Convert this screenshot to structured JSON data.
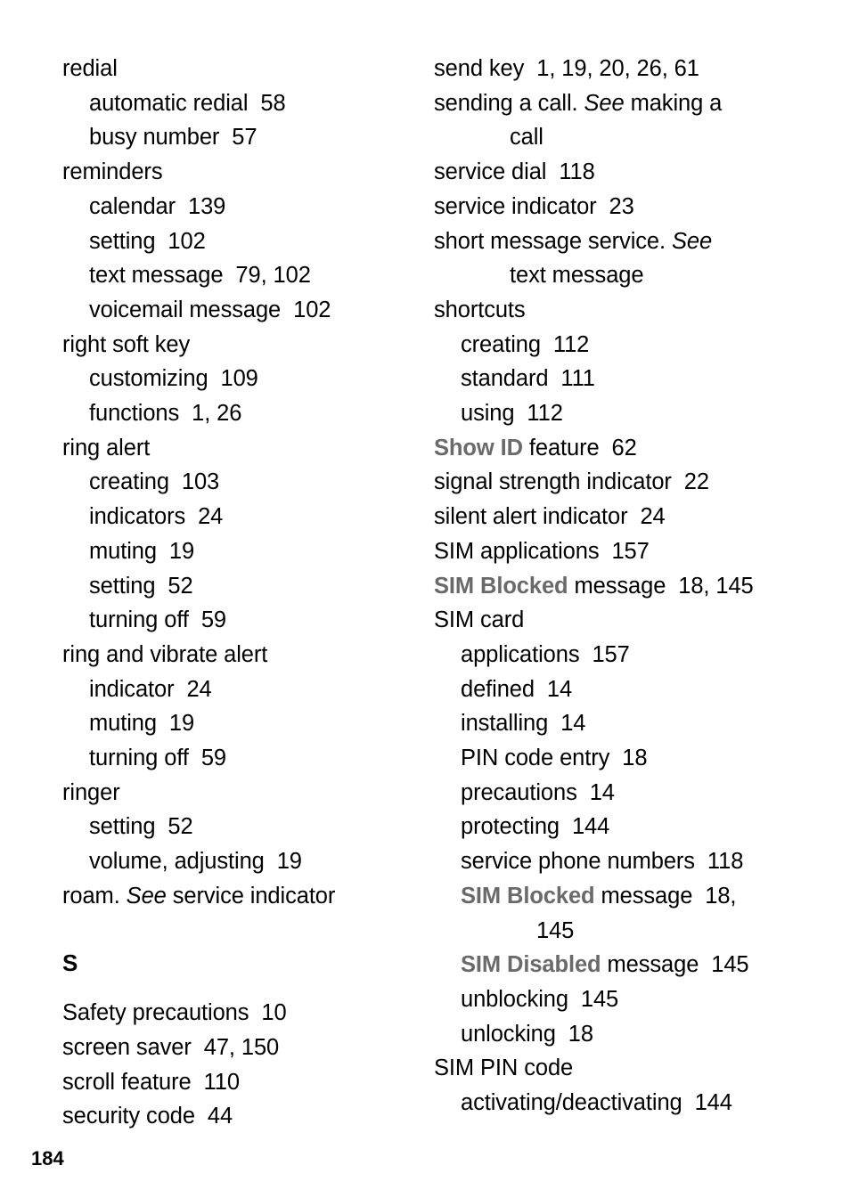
{
  "document": {
    "type": "book-index",
    "page_number": "184",
    "colors": {
      "text": "#000000",
      "ui_term": "#6a6a6a",
      "background": "#ffffff"
    }
  },
  "left_column": {
    "entries": [
      {
        "level": 1,
        "text": "redial"
      },
      {
        "level": 2,
        "text": "automatic redial  58"
      },
      {
        "level": 2,
        "text": "busy number  57"
      },
      {
        "level": 1,
        "text": "reminders"
      },
      {
        "level": 2,
        "text": "calendar  139"
      },
      {
        "level": 2,
        "text": "setting  102"
      },
      {
        "level": 2,
        "text": "text message  79, 102"
      },
      {
        "level": 2,
        "text": "voicemail message  102"
      },
      {
        "level": 1,
        "text": "right soft key"
      },
      {
        "level": 2,
        "text": "customizing  109"
      },
      {
        "level": 2,
        "text": "functions  1, 26"
      },
      {
        "level": 1,
        "text": "ring alert"
      },
      {
        "level": 2,
        "text": "creating  103"
      },
      {
        "level": 2,
        "text": "indicators  24"
      },
      {
        "level": 2,
        "text": "muting  19"
      },
      {
        "level": 2,
        "text": "setting  52"
      },
      {
        "level": 2,
        "text": "turning off  59"
      },
      {
        "level": 1,
        "text": "ring and vibrate alert"
      },
      {
        "level": 2,
        "text": "indicator  24"
      },
      {
        "level": 2,
        "text": "muting  19"
      },
      {
        "level": 2,
        "text": "turning off  59"
      },
      {
        "level": 1,
        "text": "ringer"
      },
      {
        "level": 2,
        "text": "setting  52"
      },
      {
        "level": 2,
        "text": "volume, adjusting  19"
      },
      {
        "level": 1,
        "pre": "roam. ",
        "italic": "See",
        "post": " service indicator"
      }
    ],
    "section_heading": "S",
    "entries_after_heading": [
      {
        "level": 1,
        "text": "Safety precautions  10"
      },
      {
        "level": 1,
        "text": "screen saver  47, 150"
      },
      {
        "level": 1,
        "text": "scroll feature  110"
      },
      {
        "level": 1,
        "text": "security code  44"
      }
    ]
  },
  "right_column": {
    "entries": [
      {
        "level": 1,
        "text": "send key  1, 19, 20, 26, 61"
      },
      {
        "level": 1,
        "pre": "sending a call. ",
        "italic": "See",
        "post": " making a"
      },
      {
        "level": 1,
        "wrap": 1,
        "text": "call"
      },
      {
        "level": 1,
        "text": "service dial  118"
      },
      {
        "level": 1,
        "text": "service indicator  23"
      },
      {
        "level": 1,
        "pre": "short message service. ",
        "italic": "See",
        "post": ""
      },
      {
        "level": 1,
        "wrap": 1,
        "text": "text message"
      },
      {
        "level": 1,
        "text": "shortcuts"
      },
      {
        "level": 2,
        "text": "creating  112"
      },
      {
        "level": 2,
        "text": "standard  111"
      },
      {
        "level": 2,
        "text": "using  112"
      },
      {
        "level": 1,
        "ui_term": "Show ID",
        "post": " feature  62"
      },
      {
        "level": 1,
        "text": "signal strength indicator  22"
      },
      {
        "level": 1,
        "text": "silent alert indicator  24"
      },
      {
        "level": 1,
        "text": "SIM applications  157"
      },
      {
        "level": 1,
        "ui_term": "SIM Blocked",
        "post": " message  18, 145"
      },
      {
        "level": 1,
        "text": "SIM card"
      },
      {
        "level": 2,
        "text": "applications  157"
      },
      {
        "level": 2,
        "text": "defined  14"
      },
      {
        "level": 2,
        "text": "installing  14"
      },
      {
        "level": 2,
        "text": "PIN code entry  18"
      },
      {
        "level": 2,
        "text": "precautions  14"
      },
      {
        "level": 2,
        "text": "protecting  144"
      },
      {
        "level": 2,
        "text": "service phone numbers  118"
      },
      {
        "level": 2,
        "ui_term": "SIM Blocked",
        "post": " message  18,"
      },
      {
        "level": 2,
        "wrap": 2,
        "text": "145"
      },
      {
        "level": 2,
        "ui_term": "SIM Disabled",
        "post": " message  145"
      },
      {
        "level": 2,
        "text": "unblocking  145"
      },
      {
        "level": 2,
        "text": "unlocking  18"
      },
      {
        "level": 1,
        "text": "SIM PIN code"
      },
      {
        "level": 2,
        "text": "activating/deactivating  144"
      }
    ]
  }
}
